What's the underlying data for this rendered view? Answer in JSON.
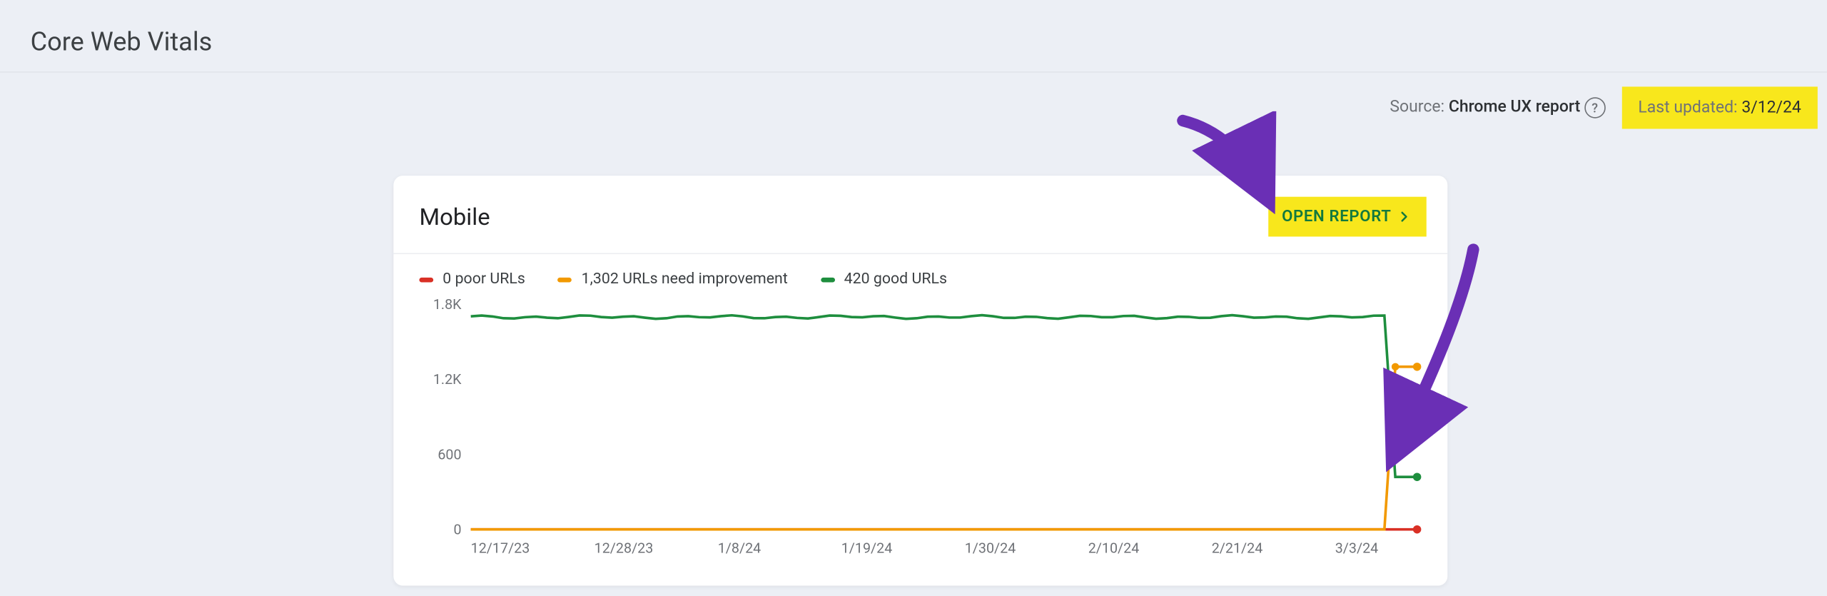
{
  "header": {
    "title": "Core Web Vitals"
  },
  "meta": {
    "source_label": "Source: ",
    "source_value": "Chrome UX report",
    "last_updated_label": "Last updated: ",
    "last_updated_date": "3/12/24"
  },
  "card": {
    "title": "Mobile",
    "open_report_label": "OPEN REPORT"
  },
  "legend": {
    "poor": "0 poor URLs",
    "needs": "1,302 URLs need improvement",
    "good": "420 good URLs"
  },
  "colors": {
    "poor": "#d93025",
    "needs": "#f29900",
    "good": "#1e8e3e",
    "highlight": "#f8e71c",
    "annotation": "#6a2fb5"
  },
  "chart_data": {
    "type": "line",
    "xlabel": "",
    "ylabel": "",
    "ylim": [
      0,
      1800
    ],
    "y_ticks": [
      0,
      600,
      1200,
      1800
    ],
    "y_tick_labels": [
      "0",
      "600",
      "1.2K",
      "1.8K"
    ],
    "x_tick_labels": [
      "12/17/23",
      "12/28/23",
      "1/8/24",
      "1/19/24",
      "1/30/24",
      "2/10/24",
      "2/21/24",
      "3/3/24"
    ],
    "n_points": 88,
    "split_index": 84,
    "series": [
      {
        "name": "poor",
        "plateau": 0,
        "end": 0
      },
      {
        "name": "needs",
        "plateau": 0,
        "end": 1302
      },
      {
        "name": "good",
        "plateau": 1700,
        "end": 420
      }
    ]
  }
}
